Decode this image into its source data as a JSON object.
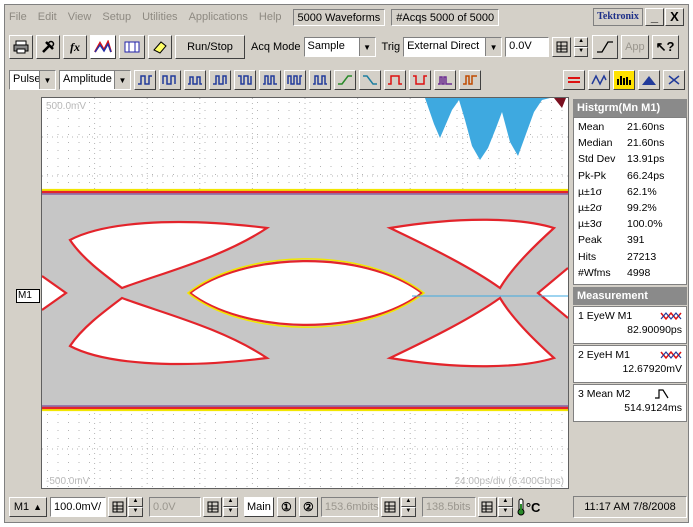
{
  "menu": [
    "File",
    "Edit",
    "View",
    "Setup",
    "Utilities",
    "Applications",
    "Help"
  ],
  "status": {
    "waveforms": "5000 Waveforms",
    "acqs": "#Acqs  5000 of 5000"
  },
  "brand": "Tektronix",
  "window_buttons": {
    "minimize": "_",
    "close": "X"
  },
  "toolbar1": {
    "run_stop": "Run/Stop",
    "acq_mode_label": "Acq Mode",
    "acq_mode_value": "Sample",
    "trig_label": "Trig",
    "trig_value": "External Direct",
    "trig_level": "0.0V",
    "app_label": "App"
  },
  "toolbar2": {
    "meas_type": "Pulse",
    "meas_param": "Amplitude"
  },
  "display": {
    "top_left_readout": "500.0mV",
    "bottom_left_readout": "-500.0mV",
    "timebase_readout": "24.00ps/div  (6.400Gbps)",
    "marker_label": "M1"
  },
  "histogram": {
    "title": "Histgrm(Mn M1)",
    "rows": [
      {
        "k": "Mean",
        "v": "21.60ns"
      },
      {
        "k": "Median",
        "v": "21.60ns"
      },
      {
        "k": "Std Dev",
        "v": "13.91ps"
      },
      {
        "k": "Pk-Pk",
        "v": "66.24ps"
      },
      {
        "k": "µ±1σ",
        "v": "62.1%"
      },
      {
        "k": "µ±2σ",
        "v": "99.2%"
      },
      {
        "k": "µ±3σ",
        "v": "100.0%"
      },
      {
        "k": "Peak",
        "v": "391"
      },
      {
        "k": "Hits",
        "v": "27213"
      },
      {
        "k": "#Wfms",
        "v": "4998"
      }
    ]
  },
  "measurement": {
    "title": "Measurement",
    "items": [
      {
        "label": "1 EyeW  M1",
        "value": "82.90090ps"
      },
      {
        "label": "2 EyeH  M1",
        "value": "12.67920mV"
      },
      {
        "label": "3 Mean  M2",
        "value": "514.9124ms"
      }
    ]
  },
  "bottom": {
    "channel": "M1",
    "scale": "100.0mV/",
    "offset": "0.0V",
    "timebase_mode": "Main",
    "bitrate1": "153.6mbits",
    "bitrate2": "138.5bits",
    "clock": "11:17 AM 7/8/2008"
  },
  "colors": {
    "grid_dot": "#b4b4b4",
    "eye_fill": "#c6c6c6",
    "eye_edge_red": "#e3242b",
    "eye_edge_yellow": "#f2e600",
    "eye_edge_purple": "#6b2c91",
    "histogram_fill": "#3ea9e0",
    "panel_header": "#8a8a8a"
  }
}
